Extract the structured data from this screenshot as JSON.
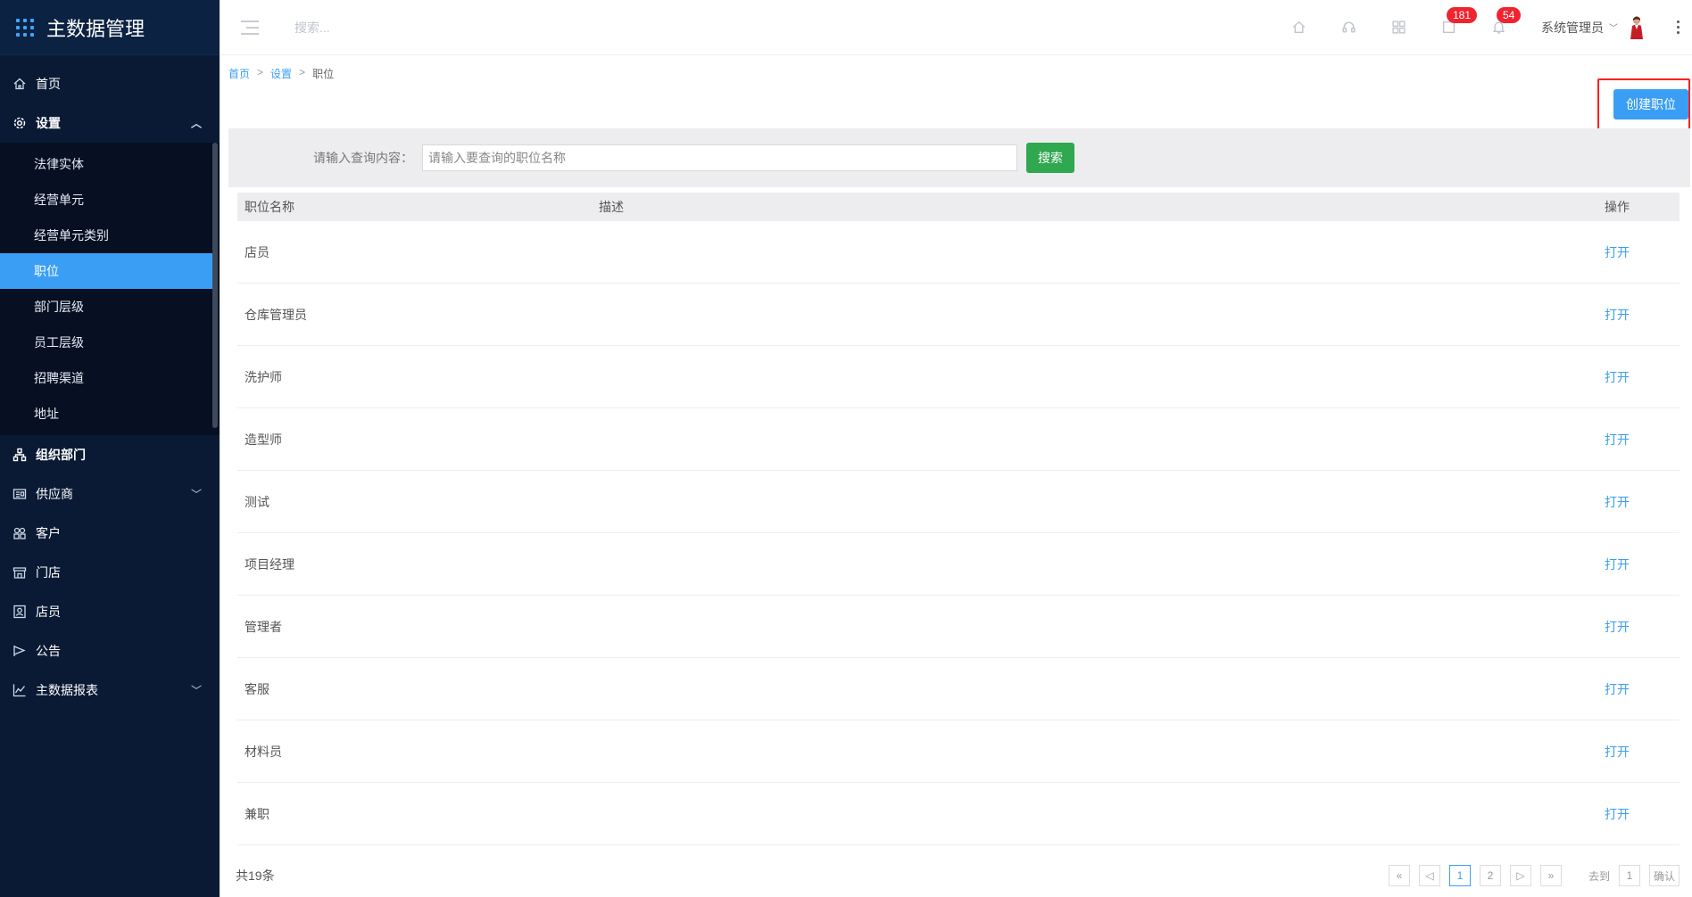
{
  "sidebar": {
    "brand": "主数据管理",
    "items": [
      {
        "label": "首页",
        "icon": "home-icon"
      },
      {
        "label": "设置",
        "icon": "gear-icon",
        "expanded": true
      },
      {
        "label": "组织部门",
        "icon": "org-icon"
      },
      {
        "label": "供应商",
        "icon": "supplier-icon"
      },
      {
        "label": "客户",
        "icon": "customer-icon"
      },
      {
        "label": "门店",
        "icon": "store-icon"
      },
      {
        "label": "店员",
        "icon": "staff-icon"
      },
      {
        "label": "公告",
        "icon": "announcement-icon"
      },
      {
        "label": "主数据报表",
        "icon": "report-icon"
      }
    ],
    "sub_items": [
      "法律实体",
      "经营单元",
      "经营单元类别",
      "职位",
      "部门层级",
      "员工层级",
      "招聘渠道",
      "地址"
    ],
    "active_sub": "职位"
  },
  "header": {
    "search_placeholder": "搜索...",
    "badge_messages": "181",
    "badge_notifications": "54",
    "user": "系统管理员"
  },
  "breadcrumb": {
    "home": "首页",
    "settings": "设置",
    "current": "职位",
    "sep": ">"
  },
  "actions": {
    "create": "创建职位"
  },
  "filter": {
    "label": "请输入查询内容：",
    "placeholder": "请输入要查询的职位名称",
    "search": "搜索"
  },
  "table": {
    "columns": {
      "name": "职位名称",
      "desc": "描述",
      "op": "操作"
    },
    "rows": [
      {
        "name": "店员",
        "desc": "",
        "op": "打开"
      },
      {
        "name": "仓库管理员",
        "desc": "",
        "op": "打开"
      },
      {
        "name": "洗护师",
        "desc": "",
        "op": "打开"
      },
      {
        "name": "造型师",
        "desc": "",
        "op": "打开"
      },
      {
        "name": "测试",
        "desc": "",
        "op": "打开"
      },
      {
        "name": "项目经理",
        "desc": "",
        "op": "打开"
      },
      {
        "name": "管理者",
        "desc": "",
        "op": "打开"
      },
      {
        "name": "客服",
        "desc": "",
        "op": "打开"
      },
      {
        "name": "材料员",
        "desc": "",
        "op": "打开"
      },
      {
        "name": "兼职",
        "desc": "",
        "op": "打开"
      }
    ]
  },
  "pagination": {
    "total": "共19条",
    "first": "«",
    "prev": "◁",
    "page1": "1",
    "page2": "2",
    "next": "▷",
    "last": "»",
    "goto_label": "去到",
    "goto_value": "1",
    "confirm": "确认"
  }
}
